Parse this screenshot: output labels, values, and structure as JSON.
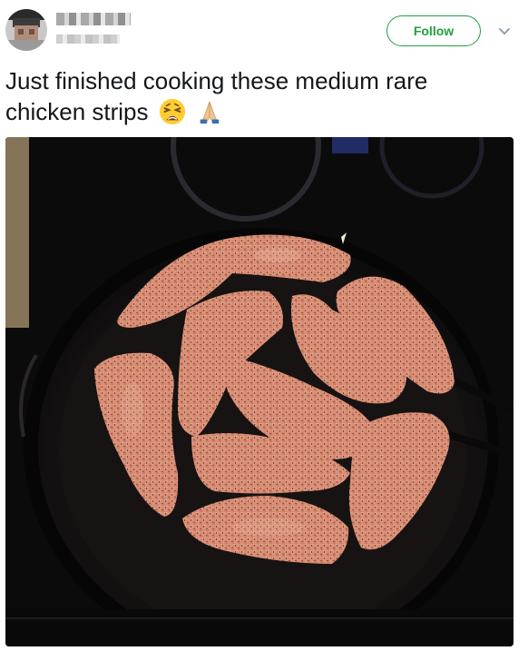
{
  "tweet": {
    "author": {
      "avatar_icon": "avatar-pixelated",
      "name_redacted": true,
      "handle_redacted": true
    },
    "follow_label": "Follow",
    "caret_icon": "chevron-down-icon",
    "text_line1": "Just finished cooking these medium rare",
    "text_line2": "chicken strips",
    "emojis": [
      "weary-face-icon",
      "folded-hands-icon"
    ],
    "photo": {
      "subject": "skillet-chicken-strips-photo"
    }
  },
  "colors": {
    "follow_green": "#1da13b",
    "text": "#14171a"
  }
}
